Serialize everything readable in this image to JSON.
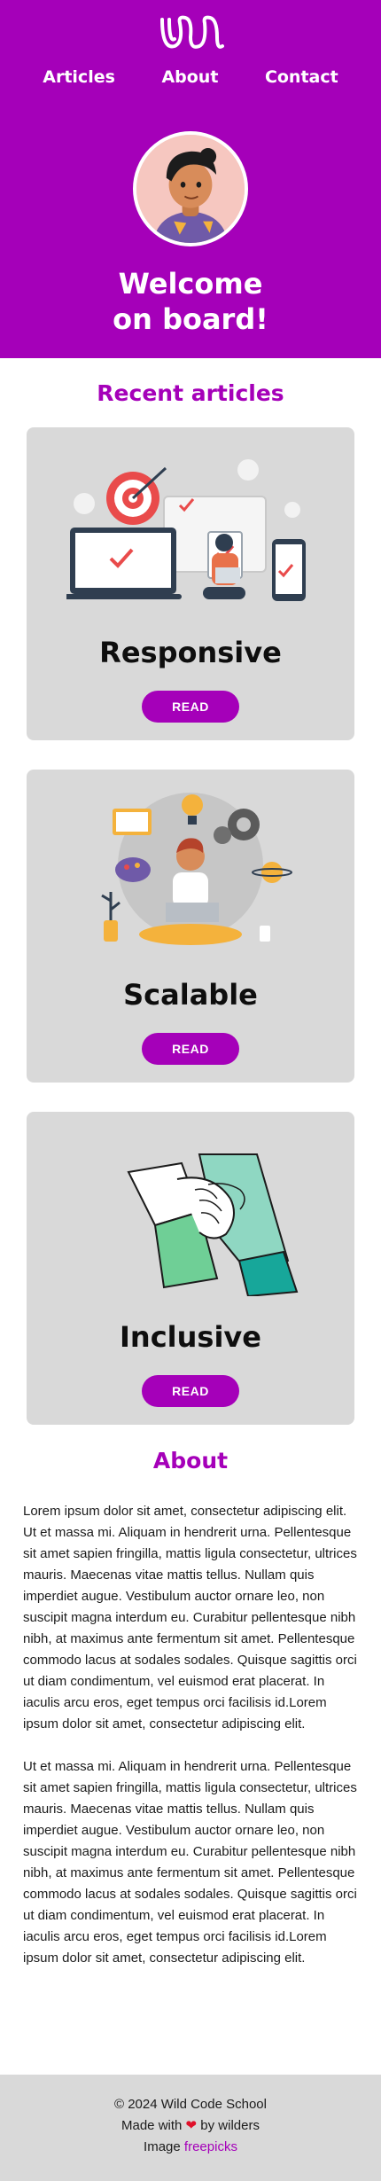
{
  "nav": {
    "articles": "Articles",
    "about": "About",
    "contact": "Contact"
  },
  "hero": {
    "title_line1": "Welcome",
    "title_line2": "on board!"
  },
  "recent": {
    "title": "Recent articles",
    "cards": [
      {
        "title": "Responsive",
        "button": "READ",
        "image": "responsive-illustration"
      },
      {
        "title": "Scalable",
        "button": "READ",
        "image": "scalable-illustration"
      },
      {
        "title": "Inclusive",
        "button": "READ",
        "image": "inclusive-illustration"
      }
    ]
  },
  "about": {
    "title": "About",
    "paragraph1": "Lorem ipsum dolor sit amet, consectetur adipiscing elit. Ut et massa mi. Aliquam in hendrerit urna. Pellentesque sit amet sapien fringilla, mattis ligula consectetur, ultrices mauris. Maecenas vitae mattis tellus. Nullam quis imperdiet augue. Vestibulum auctor ornare leo, non suscipit magna interdum eu. Curabitur pellentesque nibh nibh, at maximus ante fermentum sit amet. Pellentesque commodo lacus at sodales sodales. Quisque sagittis orci ut diam condimentum, vel euismod erat placerat. In iaculis arcu eros, eget tempus orci facilisis id.Lorem ipsum dolor sit amet, consectetur adipiscing elit.",
    "paragraph2": "Ut et massa mi. Aliquam in hendrerit urna. Pellentesque sit amet sapien fringilla, mattis ligula consectetur, ultrices mauris. Maecenas vitae mattis tellus. Nullam quis imperdiet augue. Vestibulum auctor ornare leo, non suscipit magna interdum eu. Curabitur pellentesque nibh nibh, at maximus ante fermentum sit amet. Pellentesque commodo lacus at sodales sodales. Quisque sagittis orci ut diam condimentum, vel euismod erat placerat. In iaculis arcu eros, eget tempus orci facilisis id.Lorem ipsum dolor sit amet, consectetur adipiscing elit."
  },
  "footer": {
    "copyright": "© 2024 Wild Code School",
    "made_prefix": "Made with",
    "heart": "❤",
    "made_suffix": "by wilders",
    "image_prefix": "Image",
    "image_link": "freepicks"
  },
  "colors": {
    "brand": "#a500b9",
    "card_bg": "#d9d9d9",
    "heart": "#e0102a"
  }
}
